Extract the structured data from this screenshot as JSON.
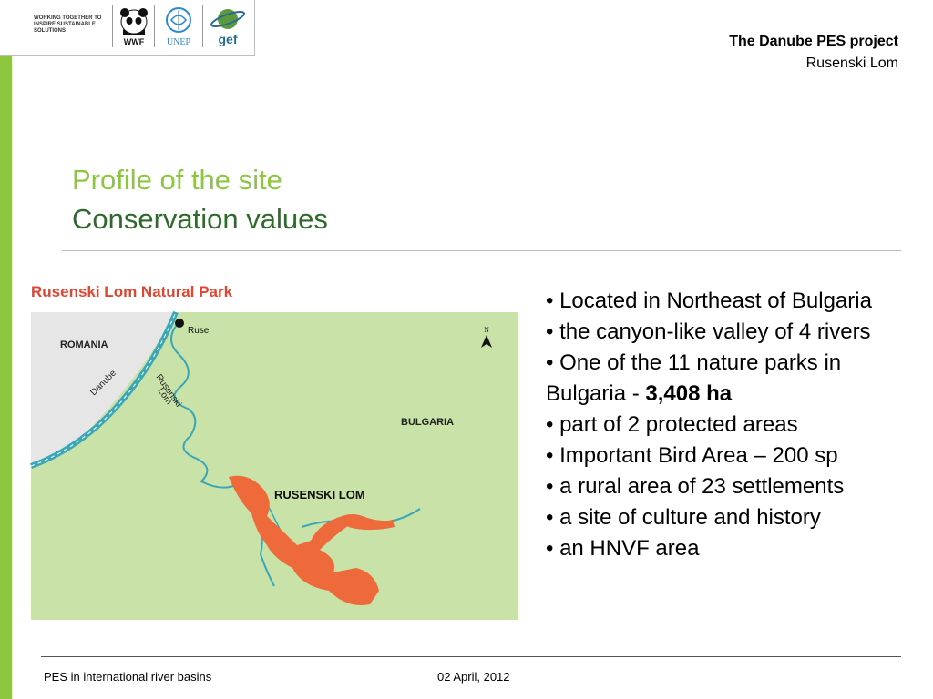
{
  "header": {
    "tagline": "WORKING TOGETHER TO INSPIRE SUSTAINABLE SOLUTIONS",
    "logos": {
      "wwf": "WWF",
      "unep": "UNEP",
      "gef": "gef"
    },
    "project_title": "The Danube PES project",
    "project_subtitle": "Rusenski Lom"
  },
  "slide": {
    "heading": "Profile of the site",
    "subheading": "Conservation values"
  },
  "map": {
    "title": "Rusenski Lom Natural Park",
    "labels": {
      "romania": "ROMANIA",
      "bulgaria": "BULGARIA",
      "ruse": "Ruse",
      "danube": "Danube",
      "river_line1": "Rusenski",
      "river_line2": "Lom",
      "park": "RUSENSKI LOM",
      "north": "N"
    }
  },
  "bullets": [
    {
      "text": "• Located in Northeast of Bulgaria"
    },
    {
      "text": "• the canyon-like valley of 4 rivers"
    },
    {
      "text": "• One of the 11 nature parks in Bulgaria  - ",
      "bold": "3,408 ha"
    },
    {
      "text": "• part of 2 protected areas"
    },
    {
      "text": "• Important Bird Area – 200 sp"
    },
    {
      "text": "• a rural area of 23 settlements"
    },
    {
      "text": "• a site of culture and history"
    },
    {
      "text": "• an HNVF area"
    }
  ],
  "footer": {
    "left": "PES in international river basins",
    "date": "02 April, 2012"
  },
  "colors": {
    "accent_green": "#8dc63f",
    "dark_green": "#2e6b2a",
    "map_land": "#c8e2a8",
    "map_river": "#3aa6b8",
    "park_orange": "#ef6a3a",
    "map_title_red": "#e2452f"
  }
}
